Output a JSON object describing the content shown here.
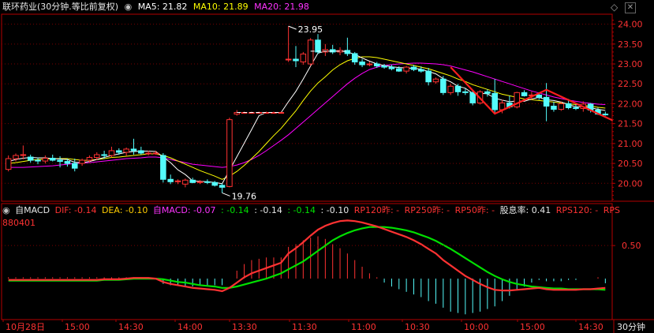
{
  "header": {
    "title": "联环药业(30分钟.等比前复权)",
    "ma5_label": "MA5: 21.82",
    "ma10_label": "MA10: 21.89",
    "ma20_label": "MA20: 21.98",
    "diamond_icon": "diamond-icon",
    "close_icon": "close-icon"
  },
  "macd_header": {
    "name": "自MACD",
    "dif": "DIF: -0.14",
    "dea": "DEA: -0.10",
    "macd": "自MACD: -0.07",
    "v1": ": -0.14",
    "v2": ": -0.14",
    "v3": ": -0.14",
    "v4": ": -0.10",
    "rp120": "RP120昨: -",
    "rp250": "RP250昨: -",
    "rp50": "RP50昨: -",
    "div": "股息率: 0.41",
    "rps120": "RPS120: -",
    "rps_tail": "RPS",
    "code": "880401"
  },
  "colors": {
    "up": "#ff3232",
    "down": "#54fcfc",
    "ma5": "#ffffff",
    "ma10": "#ffff00",
    "ma20": "#ff00ff",
    "dif": "#ff3232",
    "dea": "#00e000",
    "axis": "#b40000",
    "grid": "#7a0000"
  },
  "chart_data": [
    {
      "type": "candlestick",
      "title": "联环药业(30分钟.等比前复权)",
      "y_ticks": [
        "24.00",
        "23.50",
        "23.00",
        "22.50",
        "22.00",
        "21.50",
        "21.00",
        "20.50",
        "20.00"
      ],
      "ylim": [
        19.55,
        24.25
      ],
      "x_tick_labels": [
        "10月28日",
        "15:00",
        "14:30",
        "14:00",
        "13:30",
        "11:30",
        "11:00",
        "10:30",
        "10:00",
        "15:00",
        "14:30"
      ],
      "x_period_label": "30分钟",
      "annotations": [
        {
          "text": "23.95",
          "value": 23.95
        },
        {
          "text": "19.76",
          "value": 19.76
        }
      ],
      "candles": [
        {
          "o": 20.35,
          "h": 20.7,
          "l": 20.3,
          "c": 20.62
        },
        {
          "o": 20.62,
          "h": 20.75,
          "l": 20.55,
          "c": 20.7
        },
        {
          "o": 20.7,
          "h": 20.95,
          "l": 20.6,
          "c": 20.72
        },
        {
          "o": 20.66,
          "h": 20.72,
          "l": 20.52,
          "c": 20.58
        },
        {
          "o": 20.58,
          "h": 20.65,
          "l": 20.48,
          "c": 20.56
        },
        {
          "o": 20.56,
          "h": 20.7,
          "l": 20.5,
          "c": 20.63
        },
        {
          "o": 20.63,
          "h": 20.72,
          "l": 20.55,
          "c": 20.58
        },
        {
          "o": 20.58,
          "h": 20.68,
          "l": 20.4,
          "c": 20.55
        },
        {
          "o": 20.55,
          "h": 20.62,
          "l": 20.42,
          "c": 20.5
        },
        {
          "o": 20.5,
          "h": 20.62,
          "l": 20.3,
          "c": 20.38
        },
        {
          "o": 20.5,
          "h": 20.62,
          "l": 20.44,
          "c": 20.58
        },
        {
          "o": 20.58,
          "h": 20.7,
          "l": 20.52,
          "c": 20.65
        },
        {
          "o": 20.65,
          "h": 20.78,
          "l": 20.58,
          "c": 20.72
        },
        {
          "o": 20.72,
          "h": 20.82,
          "l": 20.62,
          "c": 20.7
        },
        {
          "o": 20.7,
          "h": 20.92,
          "l": 20.65,
          "c": 20.82
        },
        {
          "o": 20.82,
          "h": 20.88,
          "l": 20.72,
          "c": 20.78
        },
        {
          "o": 20.78,
          "h": 20.9,
          "l": 20.68,
          "c": 20.86
        },
        {
          "o": 20.86,
          "h": 21.12,
          "l": 20.72,
          "c": 20.82
        },
        {
          "o": 20.82,
          "h": 20.92,
          "l": 20.72,
          "c": 20.76
        },
        {
          "o": 20.76,
          "h": 20.82,
          "l": 20.7,
          "c": 20.76
        },
        {
          "o": 20.76,
          "h": 20.82,
          "l": 20.72,
          "c": 20.76
        },
        {
          "o": 20.7,
          "h": 20.76,
          "l": 20.02,
          "c": 20.1
        },
        {
          "o": 20.1,
          "h": 20.22,
          "l": 19.98,
          "c": 20.04
        },
        {
          "o": 20.04,
          "h": 20.1,
          "l": 19.98,
          "c": 20.06
        },
        {
          "o": 19.98,
          "h": 20.12,
          "l": 19.9,
          "c": 20.08
        },
        {
          "o": 20.08,
          "h": 20.14,
          "l": 20.0,
          "c": 20.02
        },
        {
          "o": 20.02,
          "h": 20.08,
          "l": 19.98,
          "c": 20.04
        },
        {
          "o": 20.04,
          "h": 20.1,
          "l": 19.98,
          "c": 20.02
        },
        {
          "o": 20.02,
          "h": 20.06,
          "l": 19.92,
          "c": 19.95
        },
        {
          "o": 19.95,
          "h": 20.0,
          "l": 19.76,
          "c": 19.9
        },
        {
          "o": 19.92,
          "h": 21.65,
          "l": 19.9,
          "c": 21.6
        },
        {
          "o": 21.74,
          "h": 21.84,
          "l": 21.7,
          "c": 21.78
        },
        {
          "o": 21.78,
          "h": 21.8,
          "l": 21.77,
          "c": 21.78
        },
        {
          "o": 21.78,
          "h": 21.8,
          "l": 21.77,
          "c": 21.78
        },
        {
          "o": 21.78,
          "h": 21.8,
          "l": 21.77,
          "c": 21.78
        },
        {
          "o": 21.78,
          "h": 21.8,
          "l": 21.77,
          "c": 21.78
        },
        {
          "o": 21.78,
          "h": 21.8,
          "l": 21.77,
          "c": 21.78
        },
        {
          "o": 21.78,
          "h": 21.8,
          "l": 21.77,
          "c": 21.78
        },
        {
          "o": 23.1,
          "h": 23.95,
          "l": 23.05,
          "c": 23.12
        },
        {
          "o": 23.12,
          "h": 23.45,
          "l": 22.92,
          "c": 23.08
        },
        {
          "o": 23.05,
          "h": 23.3,
          "l": 22.98,
          "c": 23.25
        },
        {
          "o": 23.0,
          "h": 23.65,
          "l": 22.95,
          "c": 23.6
        },
        {
          "o": 23.6,
          "h": 23.75,
          "l": 23.25,
          "c": 23.3
        },
        {
          "o": 23.3,
          "h": 23.5,
          "l": 23.2,
          "c": 23.36
        },
        {
          "o": 23.36,
          "h": 23.48,
          "l": 23.25,
          "c": 23.3
        },
        {
          "o": 23.3,
          "h": 23.42,
          "l": 23.22,
          "c": 23.34
        },
        {
          "o": 23.34,
          "h": 23.66,
          "l": 23.2,
          "c": 23.26
        },
        {
          "o": 23.26,
          "h": 23.3,
          "l": 22.98,
          "c": 23.05
        },
        {
          "o": 23.05,
          "h": 23.12,
          "l": 22.92,
          "c": 22.98
        },
        {
          "o": 22.98,
          "h": 23.06,
          "l": 22.94,
          "c": 23.0
        },
        {
          "o": 23.0,
          "h": 23.05,
          "l": 22.9,
          "c": 22.95
        },
        {
          "o": 22.95,
          "h": 23.0,
          "l": 22.88,
          "c": 22.92
        },
        {
          "o": 22.92,
          "h": 22.98,
          "l": 22.84,
          "c": 22.88
        },
        {
          "o": 22.88,
          "h": 22.94,
          "l": 22.8,
          "c": 22.82
        },
        {
          "o": 22.82,
          "h": 22.95,
          "l": 22.76,
          "c": 22.92
        },
        {
          "o": 22.92,
          "h": 22.98,
          "l": 22.82,
          "c": 22.86
        },
        {
          "o": 22.86,
          "h": 22.94,
          "l": 22.78,
          "c": 22.82
        },
        {
          "o": 22.82,
          "h": 22.9,
          "l": 22.46,
          "c": 22.55
        },
        {
          "o": 22.55,
          "h": 22.66,
          "l": 22.5,
          "c": 22.62
        },
        {
          "o": 22.62,
          "h": 22.7,
          "l": 22.22,
          "c": 22.28
        },
        {
          "o": 22.28,
          "h": 22.5,
          "l": 22.22,
          "c": 22.44
        },
        {
          "o": 22.44,
          "h": 22.5,
          "l": 22.2,
          "c": 22.3
        },
        {
          "o": 22.3,
          "h": 22.38,
          "l": 22.22,
          "c": 22.28
        },
        {
          "o": 22.28,
          "h": 22.35,
          "l": 21.96,
          "c": 22.02
        },
        {
          "o": 22.02,
          "h": 22.34,
          "l": 21.98,
          "c": 22.3
        },
        {
          "o": 22.3,
          "h": 22.36,
          "l": 22.18,
          "c": 22.26
        },
        {
          "o": 22.26,
          "h": 22.62,
          "l": 21.75,
          "c": 21.85
        },
        {
          "o": 21.85,
          "h": 22.1,
          "l": 21.76,
          "c": 22.02
        },
        {
          "o": 22.02,
          "h": 22.2,
          "l": 21.88,
          "c": 21.92
        },
        {
          "o": 21.92,
          "h": 22.3,
          "l": 21.88,
          "c": 22.28
        },
        {
          "o": 22.28,
          "h": 22.34,
          "l": 22.18,
          "c": 22.2
        },
        {
          "o": 22.2,
          "h": 22.3,
          "l": 22.1,
          "c": 22.22
        },
        {
          "o": 22.22,
          "h": 22.28,
          "l": 22.1,
          "c": 22.16
        },
        {
          "o": 22.16,
          "h": 22.52,
          "l": 21.56,
          "c": 21.94
        },
        {
          "o": 21.94,
          "h": 22.05,
          "l": 21.8,
          "c": 21.86
        },
        {
          "o": 21.86,
          "h": 22.06,
          "l": 21.82,
          "c": 22.0
        },
        {
          "o": 22.0,
          "h": 22.12,
          "l": 21.86,
          "c": 21.9
        },
        {
          "o": 21.9,
          "h": 21.98,
          "l": 21.84,
          "c": 21.88
        },
        {
          "o": 21.88,
          "h": 22.06,
          "l": 21.8,
          "c": 21.99
        },
        {
          "o": 21.99,
          "h": 22.02,
          "l": 21.78,
          "c": 21.84
        },
        {
          "o": 21.84,
          "h": 21.9,
          "l": 21.72,
          "c": 21.74
        },
        {
          "o": 21.74,
          "h": 21.8,
          "l": 21.7,
          "c": 21.72
        }
      ],
      "ma5": [
        20.55,
        20.6,
        20.63,
        20.65,
        20.64,
        20.64,
        20.62,
        20.61,
        20.6,
        20.53,
        20.52,
        20.55,
        20.6,
        20.65,
        20.7,
        20.74,
        20.78,
        20.8,
        20.81,
        20.81,
        20.8,
        20.66,
        20.52,
        20.34,
        20.22,
        20.06,
        20.05,
        20.04,
        20.02,
        19.99,
        20.33,
        20.67,
        21.01,
        21.35,
        21.7,
        21.78,
        21.78,
        21.78,
        22.05,
        22.31,
        22.62,
        22.95,
        23.27,
        23.32,
        23.32,
        23.33,
        23.3,
        23.24,
        23.15,
        23.07,
        23.0,
        22.96,
        22.93,
        22.91,
        22.9,
        22.89,
        22.87,
        22.81,
        22.75,
        22.63,
        22.55,
        22.44,
        22.39,
        22.26,
        22.26,
        22.25,
        22.14,
        22.09,
        22.05,
        22.07,
        22.06,
        22.12,
        22.16,
        22.1,
        22.08,
        22.04,
        21.98,
        21.92,
        21.93,
        21.9,
        21.86,
        21.83
      ],
      "ma10": [
        20.5,
        20.52,
        20.55,
        20.58,
        20.6,
        20.61,
        20.62,
        20.62,
        20.62,
        20.6,
        20.58,
        20.58,
        20.6,
        20.62,
        20.65,
        20.66,
        20.68,
        20.7,
        20.72,
        20.74,
        20.74,
        20.7,
        20.64,
        20.56,
        20.48,
        20.4,
        20.32,
        20.25,
        20.18,
        20.1,
        20.18,
        20.3,
        20.45,
        20.62,
        20.8,
        21.0,
        21.2,
        21.38,
        21.6,
        21.82,
        22.08,
        22.32,
        22.52,
        22.68,
        22.85,
        22.98,
        23.08,
        23.14,
        23.18,
        23.18,
        23.16,
        23.12,
        23.08,
        23.04,
        23.0,
        22.96,
        22.92,
        22.88,
        22.82,
        22.76,
        22.7,
        22.62,
        22.56,
        22.48,
        22.42,
        22.36,
        22.3,
        22.24,
        22.2,
        22.16,
        22.12,
        22.1,
        22.08,
        22.06,
        22.04,
        22.02,
        22.0,
        21.98,
        21.96,
        21.94,
        21.91,
        21.89
      ],
      "ma20": [
        20.4,
        20.4,
        20.4,
        20.41,
        20.42,
        20.43,
        20.44,
        20.46,
        20.48,
        20.5,
        20.51,
        20.52,
        20.54,
        20.56,
        20.58,
        20.6,
        20.62,
        20.63,
        20.64,
        20.66,
        20.66,
        20.64,
        20.6,
        20.56,
        20.52,
        20.48,
        20.46,
        20.44,
        20.42,
        20.4,
        20.42,
        20.46,
        20.52,
        20.6,
        20.7,
        20.82,
        20.95,
        21.08,
        21.22,
        21.38,
        21.54,
        21.7,
        21.86,
        22.02,
        22.18,
        22.34,
        22.5,
        22.64,
        22.76,
        22.86,
        22.92,
        22.96,
        22.98,
        23.0,
        23.01,
        23.02,
        23.02,
        23.01,
        23.0,
        22.98,
        22.95,
        22.9,
        22.85,
        22.8,
        22.74,
        22.68,
        22.62,
        22.56,
        22.5,
        22.44,
        22.38,
        22.32,
        22.27,
        22.22,
        22.17,
        22.13,
        22.09,
        22.06,
        22.03,
        22.01,
        21.99,
        21.98
      ],
      "trend_line": [
        {
          "i": 60,
          "v": 22.92
        },
        {
          "i": 66,
          "v": 21.75
        },
        {
          "i": 73,
          "v": 22.35
        },
        {
          "i": 82,
          "v": 21.58
        }
      ]
    },
    {
      "type": "bar",
      "title": "自MACD",
      "series": [
        {
          "name": "DIF",
          "values": [
            -0.02,
            -0.02,
            -0.02,
            -0.02,
            -0.02,
            -0.02,
            -0.02,
            -0.02,
            -0.02,
            -0.02,
            -0.02,
            -0.02,
            -0.02,
            -0.01,
            -0.01,
            -0.01,
            0.0,
            0.01,
            0.01,
            0.01,
            0.0,
            -0.05,
            -0.08,
            -0.1,
            -0.12,
            -0.14,
            -0.15,
            -0.16,
            -0.17,
            -0.19,
            -0.14,
            -0.06,
            0.02,
            0.08,
            0.12,
            0.16,
            0.2,
            0.24,
            0.38,
            0.46,
            0.55,
            0.65,
            0.74,
            0.8,
            0.84,
            0.87,
            0.88,
            0.87,
            0.85,
            0.82,
            0.79,
            0.75,
            0.71,
            0.67,
            0.63,
            0.58,
            0.52,
            0.45,
            0.38,
            0.28,
            0.2,
            0.12,
            0.04,
            -0.02,
            -0.08,
            -0.13,
            -0.17,
            -0.18,
            -0.18,
            -0.17,
            -0.16,
            -0.15,
            -0.14,
            -0.16,
            -0.17,
            -0.17,
            -0.17,
            -0.17,
            -0.16,
            -0.16,
            -0.15,
            -0.14
          ]
        },
        {
          "name": "DEA",
          "values": [
            -0.03,
            -0.03,
            -0.03,
            -0.03,
            -0.03,
            -0.03,
            -0.03,
            -0.03,
            -0.03,
            -0.03,
            -0.03,
            -0.03,
            -0.03,
            -0.02,
            -0.02,
            -0.02,
            -0.01,
            0.0,
            0.0,
            0.0,
            0.0,
            -0.01,
            -0.03,
            -0.05,
            -0.06,
            -0.08,
            -0.1,
            -0.11,
            -0.12,
            -0.14,
            -0.14,
            -0.12,
            -0.09,
            -0.06,
            -0.03,
            0.0,
            0.04,
            0.08,
            0.14,
            0.2,
            0.26,
            0.34,
            0.42,
            0.5,
            0.58,
            0.64,
            0.69,
            0.73,
            0.76,
            0.78,
            0.78,
            0.78,
            0.77,
            0.75,
            0.73,
            0.7,
            0.66,
            0.62,
            0.57,
            0.51,
            0.45,
            0.38,
            0.31,
            0.24,
            0.17,
            0.1,
            0.04,
            -0.01,
            -0.05,
            -0.08,
            -0.1,
            -0.12,
            -0.13,
            -0.14,
            -0.15,
            -0.15,
            -0.16,
            -0.16,
            -0.16,
            -0.16,
            -0.16,
            -0.17
          ]
        },
        {
          "name": "自MACD",
          "values": [
            0.02,
            0.02,
            0.02,
            0.02,
            0.02,
            0.02,
            0.02,
            0.02,
            0.02,
            0.02,
            0.02,
            0.02,
            0.02,
            0.02,
            0.02,
            0.02,
            0.02,
            0.02,
            0.02,
            0.02,
            0.0,
            -0.08,
            -0.1,
            -0.1,
            -0.12,
            -0.12,
            -0.1,
            -0.1,
            -0.1,
            -0.1,
            0.0,
            0.12,
            0.22,
            0.28,
            0.3,
            0.32,
            0.32,
            0.32,
            0.48,
            0.52,
            0.58,
            0.62,
            0.64,
            0.6,
            0.52,
            0.46,
            0.38,
            0.28,
            0.18,
            0.08,
            0.02,
            -0.06,
            -0.12,
            -0.16,
            -0.2,
            -0.24,
            -0.28,
            -0.34,
            -0.38,
            -0.44,
            -0.5,
            -0.52,
            -0.54,
            -0.52,
            -0.5,
            -0.46,
            -0.42,
            -0.34,
            -0.26,
            -0.18,
            -0.12,
            -0.06,
            -0.02,
            -0.04,
            -0.04,
            -0.04,
            -0.02,
            -0.02,
            0.0,
            0.0,
            0.02,
            -0.07
          ]
        }
      ],
      "y_ticks": [
        "0.50"
      ],
      "ylim": [
        -0.62,
        0.92
      ]
    }
  ]
}
